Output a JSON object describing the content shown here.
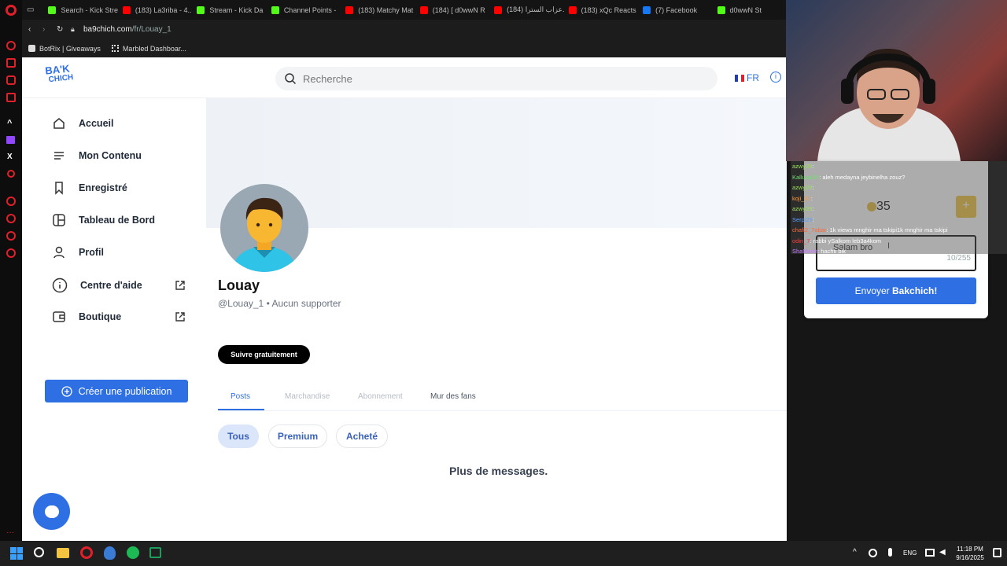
{
  "browser": {
    "tabs": [
      {
        "label": "Search - Kick Stre",
        "color": "#53fc18"
      },
      {
        "label": "(183) La3riba - 4...",
        "color": "#ff0000"
      },
      {
        "label": "Stream - Kick Da",
        "color": "#53fc18"
      },
      {
        "label": "Channel Points - ",
        "color": "#53fc18"
      },
      {
        "label": "(183) Matchy Mat",
        "color": "#ff0000"
      },
      {
        "label": "(184) [ d0wwN R",
        "color": "#ff0000"
      },
      {
        "label": "(184) عزاب السترا...",
        "color": "#ff0000"
      },
      {
        "label": "(183) xQc Reacts",
        "color": "#ff0000"
      },
      {
        "label": "(7) Facebook",
        "color": "#1877f2"
      },
      {
        "label": "d0wwN St",
        "color": "#53fc18"
      }
    ],
    "url_host": "ba9chich.com",
    "url_path": "/fr/Louay_1",
    "bookmarks": [
      "BotRix | Giveaways",
      "Marbled Dashboar..."
    ]
  },
  "site": {
    "logo_top": "BA'K",
    "logo_bottom": "CHICH",
    "search_placeholder": "Recherche",
    "lang": "FR"
  },
  "nav": {
    "items": [
      "Accueil",
      "Mon Contenu",
      "Enregistré",
      "Tableau de Bord",
      "Profil",
      "Centre d'aide",
      "Boutique"
    ],
    "create": "Créer une publication"
  },
  "profile": {
    "name": "Louay",
    "handle": "@Louay_1",
    "supporters": "Aucun supporter",
    "follow": "Suivre gratuitement",
    "tabs": [
      "Posts",
      "Marchandise",
      "Abonnement",
      "Mur des fans"
    ],
    "filters": [
      "Tous",
      "Premium",
      "Acheté"
    ],
    "empty": "Plus de messages."
  },
  "donation": {
    "amount": "35",
    "plus": "+",
    "message": "Salam bro",
    "counter": "10/255",
    "send_prefix": "Envoyer ",
    "send_bold": "Bakchich!"
  },
  "chat": [
    {
      "user": "azwy29",
      "msg": "",
      "color": "#9be35a"
    },
    {
      "user": "Kalluaa3X",
      "msg": "aleh medayna jeybinelha zouz?",
      "color": "#6fe06f"
    },
    {
      "user": "azwy29",
      "msg": "",
      "color": "#9be35a"
    },
    {
      "user": "koji_67",
      "msg": "",
      "color": "#ff9a3c"
    },
    {
      "user": "azwy29",
      "msg": "",
      "color": "#9be35a"
    },
    {
      "user": "Serpi29",
      "msg": "",
      "color": "#5aa0ff"
    },
    {
      "user": "chafi2_7abar",
      "msg": "1k views mnghir ma tskipi1k mnghir ma tskipi",
      "color": "#ff6a3c"
    },
    {
      "user": "odin_7",
      "msg": "rabbi ySalkom leb3a4kom",
      "color": "#ff3c3c"
    },
    {
      "user": "Sha9fade",
      "msg": "hachti bik",
      "color": "#c77dff"
    }
  ],
  "taskbar": {
    "lang": "ENG",
    "time": "11:18 PM",
    "date": "9/16/2025"
  }
}
